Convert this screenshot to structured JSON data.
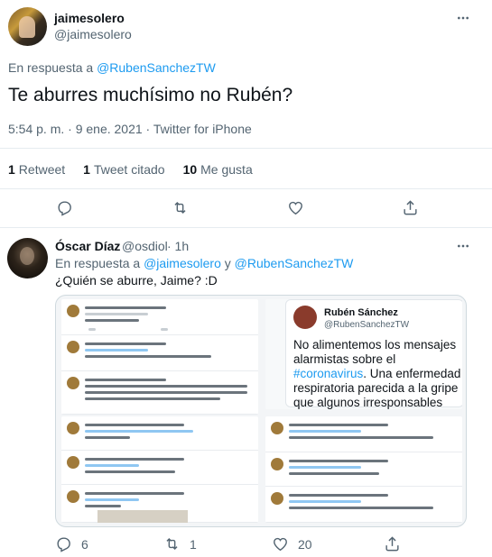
{
  "main_tweet": {
    "display_name": "jaimesolero",
    "handle": "@jaimesolero",
    "reply_prefix": "En respuesta a",
    "reply_to": "@RubenSanchezTW",
    "text": "Te aburres muchísimo no Rubén?",
    "timestamp": "5:54 p. m. · 9 ene. 2021 · Twitter for iPhone",
    "stats": {
      "retweets_count": "1",
      "retweets_label": "Retweet",
      "quotes_count": "1",
      "quotes_label": "Tweet citado",
      "likes_count": "10",
      "likes_label": "Me gusta"
    }
  },
  "reply_tweet": {
    "display_name": "Óscar Díaz",
    "handle": "@osdiol",
    "time": "· 1h",
    "reply_prefix": "En respuesta a",
    "reply_to_1": "@jaimesolero",
    "reply_join": "y",
    "reply_to_2": "@RubenSanchezTW",
    "text": "¿Quién se aburre, Jaime? :D",
    "actions": {
      "replies": "6",
      "retweets": "1",
      "likes": "20"
    }
  },
  "embedded_card": {
    "name": "Rubén Sánchez",
    "handle": "@RubenSanchezTW",
    "text_before": "No alimentemos los mensajes alarmistas sobre el ",
    "hashtag": "#coronavirus",
    "text_after": ". Una enfermedad respiratoria parecida a la gripe que algunos irresponsables están presentando"
  },
  "icons": [
    "more-icon",
    "reply-icon",
    "retweet-icon",
    "like-icon",
    "share-icon"
  ],
  "colors": {
    "accent": "#1d9bf0",
    "text": "#0f1419",
    "muted": "#536471",
    "border": "#e6ecf0"
  }
}
